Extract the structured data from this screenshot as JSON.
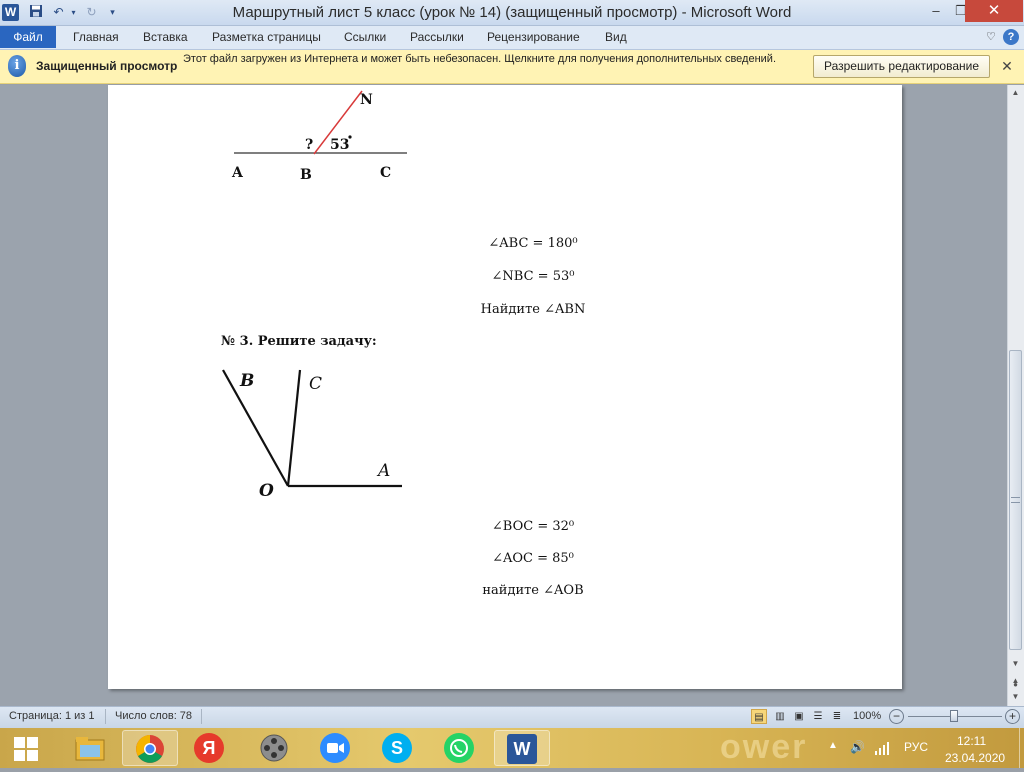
{
  "window": {
    "title": "Маршрутный лист 5 класс (урок № 14) (защищенный просмотр)  -  Microsoft Word",
    "app_letter": "W",
    "minimize": "–",
    "restore": "❐",
    "close": "✕"
  },
  "quick_access": {
    "save_icon": "save-icon",
    "undo_icon": "undo-icon",
    "redo_icon": "redo-icon",
    "customize_icon": "customize-icon"
  },
  "ribbon": {
    "file_tab": "Файл",
    "tabs": [
      "Главная",
      "Вставка",
      "Разметка страницы",
      "Ссылки",
      "Рассылки",
      "Рецензирование",
      "Вид"
    ]
  },
  "protected_view": {
    "title": "Защищенный просмотр",
    "message": "Этот файл загружен из Интернета и может быть небезопасен. Щелкните для получения дополнительных сведений.",
    "enable_button": "Разрешить редактирование",
    "close": "✕"
  },
  "document": {
    "figure1": {
      "labels": {
        "n": "N",
        "q": "?",
        "angle": "53",
        "a": "A",
        "b": "B",
        "c": "C"
      }
    },
    "task2_lines": [
      "∠ABC = 180⁰",
      "∠NBC = 53⁰",
      "Найдите ∠ABN"
    ],
    "task3_heading": "№ 3. Решите задачу:",
    "figure2": {
      "labels": {
        "b": "B",
        "c": "C",
        "a": "A",
        "o": "O"
      }
    },
    "task3_lines": [
      "∠BOC = 32⁰",
      "∠AOC = 85⁰",
      "найдите ∠AOB"
    ]
  },
  "status_bar": {
    "page": "Страница: 1 из 1",
    "words": "Число слов: 78",
    "zoom": "100%",
    "zoom_level_percent": 100
  },
  "taskbar": {
    "watermark": "ower",
    "language": "РУС",
    "time": "12:11",
    "date": "23.04.2020",
    "apps": [
      {
        "name": "file-explorer",
        "icon": "folder-icon"
      },
      {
        "name": "chrome",
        "icon": "chrome-icon"
      },
      {
        "name": "yandex-browser",
        "icon": "yandex-icon",
        "glyph": "Я"
      },
      {
        "name": "media-player",
        "icon": "film-reel-icon"
      },
      {
        "name": "zoom",
        "icon": "zoom-camera-icon"
      },
      {
        "name": "skype",
        "icon": "skype-icon",
        "glyph": "S"
      },
      {
        "name": "whatsapp",
        "icon": "whatsapp-icon"
      },
      {
        "name": "word",
        "icon": "word-icon",
        "glyph": "W"
      }
    ]
  },
  "colors": {
    "accent": "#2a66c0",
    "protected_bar": "#fff3b4",
    "close_button": "#c7493c",
    "red_line": "#d83a3a"
  }
}
